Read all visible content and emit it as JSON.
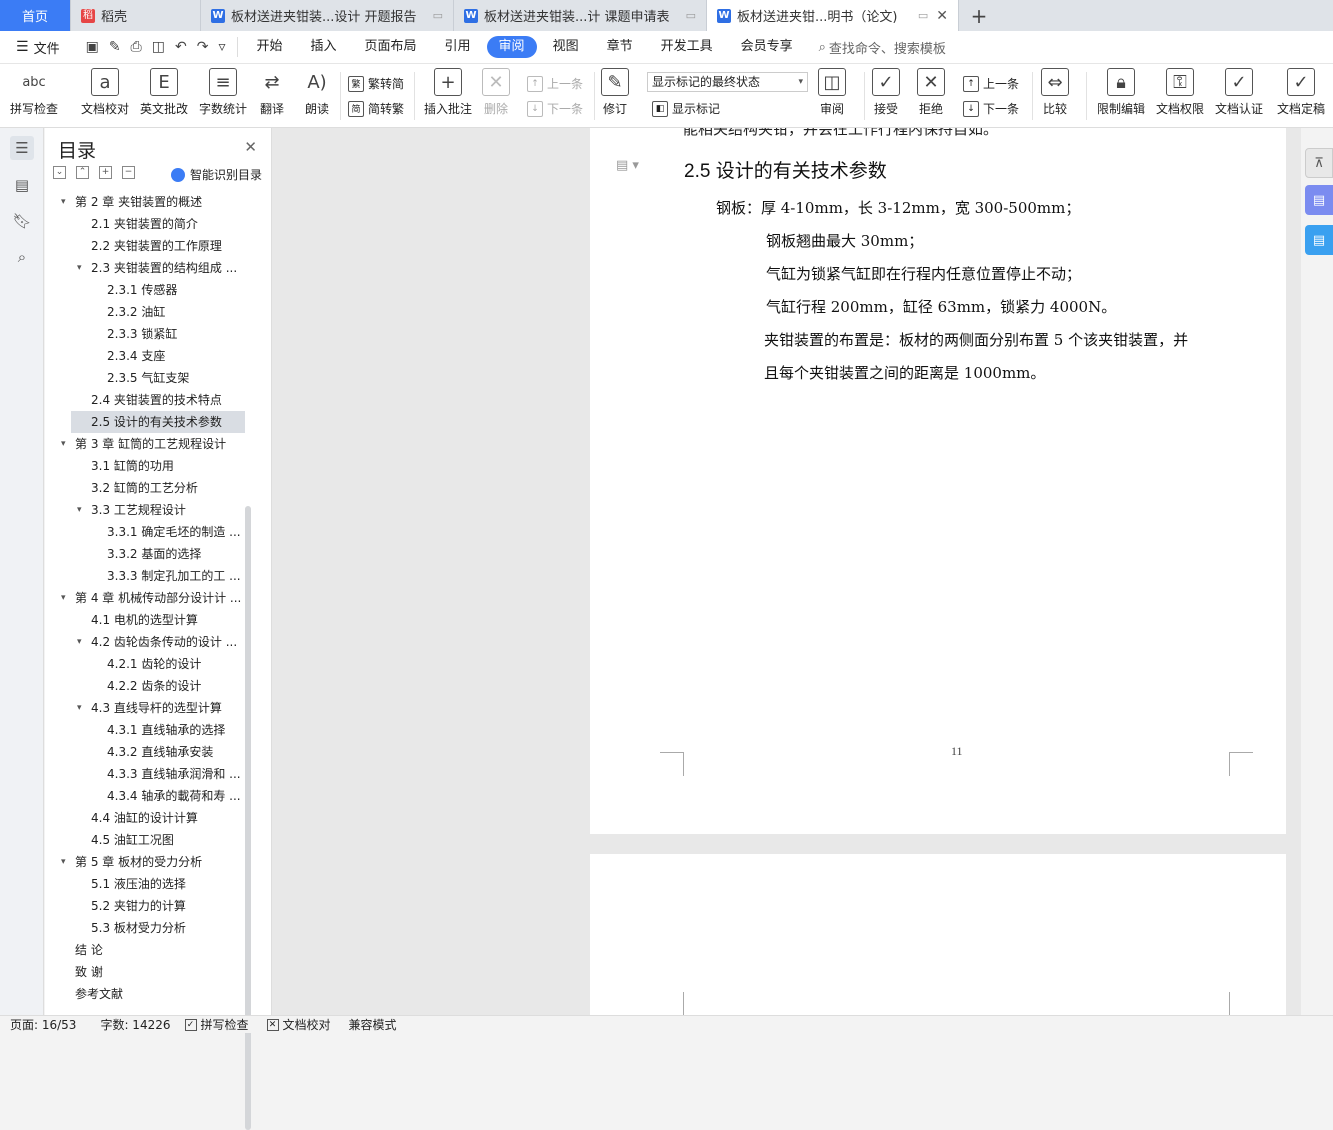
{
  "tabs": [
    {
      "label": "首页"
    },
    {
      "label": "稻壳"
    },
    {
      "label": "板材送进夹钳装...设计 开题报告"
    },
    {
      "label": "板材送进夹钳装...计 课题申请表"
    },
    {
      "label": "板材送进夹钳...明书（论文)"
    }
  ],
  "menu": {
    "file": "文件",
    "items": [
      "开始",
      "插入",
      "页面布局",
      "引用",
      "审阅",
      "视图",
      "章节",
      "开发工具",
      "会员专享"
    ],
    "active_index": 4,
    "search_placeholder": "查找命令、搜索模板"
  },
  "ribbon": {
    "spell": "拼写检查",
    "proof": "文档校对",
    "english": "英文批改",
    "wordcount": "字数统计",
    "translate": "翻译",
    "read": "朗读",
    "trad": "繁转简",
    "simp": "简转繁",
    "insert_comment": "插入批注",
    "delete": "删除",
    "prev": "上一条",
    "next": "下一条",
    "revise": "修订",
    "markup_state": "显示标记的最终状态",
    "show_markup": "显示标记",
    "review": "审阅",
    "accept": "接受",
    "reject": "拒绝",
    "prev2": "上一条",
    "next2": "下一条",
    "compare": "比较",
    "restrict": "限制编辑",
    "permission": "文档权限",
    "certify": "文档认证",
    "finalize": "文档定稿"
  },
  "toc": {
    "title": "目录",
    "smart": "智能识别目录",
    "items": [
      {
        "text": "第 2 章  夹钳装置的概述",
        "level": 1,
        "chev": "down"
      },
      {
        "text": "2.1  夹钳装置的简介",
        "level": 2
      },
      {
        "text": "2.2  夹钳装置的工作原理",
        "level": 2
      },
      {
        "text": "2.3  夹钳装置的结构组成 ...",
        "level": 2,
        "chev": "down"
      },
      {
        "text": "2.3.1  传感器",
        "level": 3
      },
      {
        "text": "2.3.2  油缸",
        "level": 3
      },
      {
        "text": "2.3.3  锁紧缸",
        "level": 3
      },
      {
        "text": "2.3.4  支座",
        "level": 3
      },
      {
        "text": "2.3.5  气缸支架",
        "level": 3
      },
      {
        "text": "2.4  夹钳装置的技术特点",
        "level": 2
      },
      {
        "text": "2.5  设计的有关技术参数",
        "level": 2,
        "selected": true
      },
      {
        "text": "第 3 章  缸筒的工艺规程设计",
        "level": 1,
        "chev": "down"
      },
      {
        "text": "3.1  缸筒的功用",
        "level": 2
      },
      {
        "text": "3.2  缸筒的工艺分析",
        "level": 2
      },
      {
        "text": "3.3  工艺规程设计",
        "level": 2,
        "chev": "down"
      },
      {
        "text": "3.3.1  确定毛坯的制造 ...",
        "level": 3
      },
      {
        "text": "3.3.2  基面的选择",
        "level": 3
      },
      {
        "text": "3.3.3  制定孔加工的工 ...",
        "level": 3
      },
      {
        "text": "第 4 章  机械传动部分设计计 ...",
        "level": 1,
        "chev": "down"
      },
      {
        "text": "4.1 电机的选型计算",
        "level": 2
      },
      {
        "text": "4.2 齿轮齿条传动的设计 ...",
        "level": 2,
        "chev": "down"
      },
      {
        "text": "4.2.1 齿轮的设计",
        "level": 3
      },
      {
        "text": "4.2.2 齿条的设计",
        "level": 3
      },
      {
        "text": "4.3 直线导杆的选型计算",
        "level": 2,
        "chev": "down"
      },
      {
        "text": "4.3.1 直线轴承的选择",
        "level": 3
      },
      {
        "text": "4.3.2 直线轴承安装",
        "level": 3
      },
      {
        "text": "4.3.3 直线轴承润滑和 ...",
        "level": 3
      },
      {
        "text": "4.3.4 轴承的載荷和寿 ...",
        "level": 3
      },
      {
        "text": "4.4 油缸的设计计算",
        "level": 2
      },
      {
        "text": "4.5 油缸工况图",
        "level": 2
      },
      {
        "text": "第 5 章  板材的受力分析",
        "level": 1,
        "chev": "down"
      },
      {
        "text": "5.1  液压油的选择",
        "level": 2
      },
      {
        "text": "5.2  夹钳力的计算",
        "level": 2
      },
      {
        "text": "5.3  板材受力分析",
        "level": 2
      },
      {
        "text": "结    论",
        "level": 1
      },
      {
        "text": "致    谢",
        "level": 1
      },
      {
        "text": "参考文献",
        "level": 1
      }
    ]
  },
  "doc": {
    "partial_top": "能相关结构夹钳，并会在工作行程内保持自如。",
    "heading": "2.5  设计的有关技术参数",
    "lines": [
      "钢板：厚 4-10mm，长 3-12mm，宽 300-500mm；",
      "钢板翘曲最大 30mm；",
      "气缸为锁紧气缸即在行程内任意位置停止不动；",
      "气缸行程 200mm，缸径 63mm，锁紧力 4000N。",
      "夹钳装置的布置是：板材的两侧面分别布置 5 个该夹钳装置，并",
      "且每个夹钳装置之间的距离是 1000mm。"
    ],
    "page_number": "11"
  },
  "status": {
    "page": "页面: 16/53",
    "words": "字数: 14226",
    "spell": "拼写检查",
    "proof": "文档校对",
    "compat": "兼容模式"
  }
}
